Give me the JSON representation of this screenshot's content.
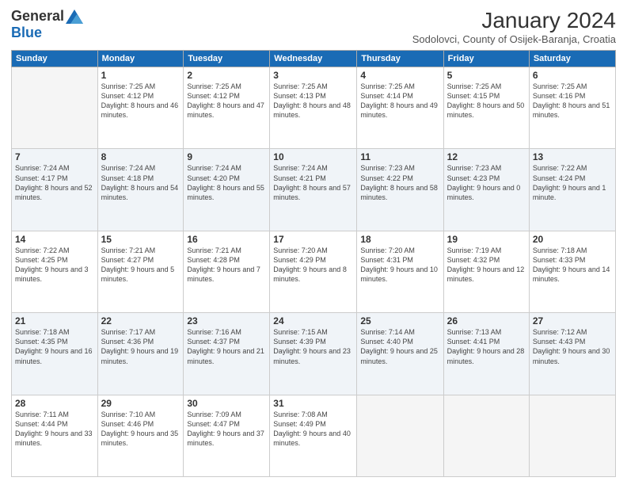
{
  "header": {
    "logo_general": "General",
    "logo_blue": "Blue",
    "month_title": "January 2024",
    "subtitle": "Sodolovci, County of Osijek-Baranja, Croatia"
  },
  "days_of_week": [
    "Sunday",
    "Monday",
    "Tuesday",
    "Wednesday",
    "Thursday",
    "Friday",
    "Saturday"
  ],
  "weeks": [
    [
      {
        "day": "",
        "empty": true
      },
      {
        "day": "1",
        "sunrise": "Sunrise: 7:25 AM",
        "sunset": "Sunset: 4:12 PM",
        "daylight": "Daylight: 8 hours and 46 minutes."
      },
      {
        "day": "2",
        "sunrise": "Sunrise: 7:25 AM",
        "sunset": "Sunset: 4:12 PM",
        "daylight": "Daylight: 8 hours and 47 minutes."
      },
      {
        "day": "3",
        "sunrise": "Sunrise: 7:25 AM",
        "sunset": "Sunset: 4:13 PM",
        "daylight": "Daylight: 8 hours and 48 minutes."
      },
      {
        "day": "4",
        "sunrise": "Sunrise: 7:25 AM",
        "sunset": "Sunset: 4:14 PM",
        "daylight": "Daylight: 8 hours and 49 minutes."
      },
      {
        "day": "5",
        "sunrise": "Sunrise: 7:25 AM",
        "sunset": "Sunset: 4:15 PM",
        "daylight": "Daylight: 8 hours and 50 minutes."
      },
      {
        "day": "6",
        "sunrise": "Sunrise: 7:25 AM",
        "sunset": "Sunset: 4:16 PM",
        "daylight": "Daylight: 8 hours and 51 minutes."
      }
    ],
    [
      {
        "day": "7",
        "sunrise": "Sunrise: 7:24 AM",
        "sunset": "Sunset: 4:17 PM",
        "daylight": "Daylight: 8 hours and 52 minutes."
      },
      {
        "day": "8",
        "sunrise": "Sunrise: 7:24 AM",
        "sunset": "Sunset: 4:18 PM",
        "daylight": "Daylight: 8 hours and 54 minutes."
      },
      {
        "day": "9",
        "sunrise": "Sunrise: 7:24 AM",
        "sunset": "Sunset: 4:20 PM",
        "daylight": "Daylight: 8 hours and 55 minutes."
      },
      {
        "day": "10",
        "sunrise": "Sunrise: 7:24 AM",
        "sunset": "Sunset: 4:21 PM",
        "daylight": "Daylight: 8 hours and 57 minutes."
      },
      {
        "day": "11",
        "sunrise": "Sunrise: 7:23 AM",
        "sunset": "Sunset: 4:22 PM",
        "daylight": "Daylight: 8 hours and 58 minutes."
      },
      {
        "day": "12",
        "sunrise": "Sunrise: 7:23 AM",
        "sunset": "Sunset: 4:23 PM",
        "daylight": "Daylight: 9 hours and 0 minutes."
      },
      {
        "day": "13",
        "sunrise": "Sunrise: 7:22 AM",
        "sunset": "Sunset: 4:24 PM",
        "daylight": "Daylight: 9 hours and 1 minute."
      }
    ],
    [
      {
        "day": "14",
        "sunrise": "Sunrise: 7:22 AM",
        "sunset": "Sunset: 4:25 PM",
        "daylight": "Daylight: 9 hours and 3 minutes."
      },
      {
        "day": "15",
        "sunrise": "Sunrise: 7:21 AM",
        "sunset": "Sunset: 4:27 PM",
        "daylight": "Daylight: 9 hours and 5 minutes."
      },
      {
        "day": "16",
        "sunrise": "Sunrise: 7:21 AM",
        "sunset": "Sunset: 4:28 PM",
        "daylight": "Daylight: 9 hours and 7 minutes."
      },
      {
        "day": "17",
        "sunrise": "Sunrise: 7:20 AM",
        "sunset": "Sunset: 4:29 PM",
        "daylight": "Daylight: 9 hours and 8 minutes."
      },
      {
        "day": "18",
        "sunrise": "Sunrise: 7:20 AM",
        "sunset": "Sunset: 4:31 PM",
        "daylight": "Daylight: 9 hours and 10 minutes."
      },
      {
        "day": "19",
        "sunrise": "Sunrise: 7:19 AM",
        "sunset": "Sunset: 4:32 PM",
        "daylight": "Daylight: 9 hours and 12 minutes."
      },
      {
        "day": "20",
        "sunrise": "Sunrise: 7:18 AM",
        "sunset": "Sunset: 4:33 PM",
        "daylight": "Daylight: 9 hours and 14 minutes."
      }
    ],
    [
      {
        "day": "21",
        "sunrise": "Sunrise: 7:18 AM",
        "sunset": "Sunset: 4:35 PM",
        "daylight": "Daylight: 9 hours and 16 minutes."
      },
      {
        "day": "22",
        "sunrise": "Sunrise: 7:17 AM",
        "sunset": "Sunset: 4:36 PM",
        "daylight": "Daylight: 9 hours and 19 minutes."
      },
      {
        "day": "23",
        "sunrise": "Sunrise: 7:16 AM",
        "sunset": "Sunset: 4:37 PM",
        "daylight": "Daylight: 9 hours and 21 minutes."
      },
      {
        "day": "24",
        "sunrise": "Sunrise: 7:15 AM",
        "sunset": "Sunset: 4:39 PM",
        "daylight": "Daylight: 9 hours and 23 minutes."
      },
      {
        "day": "25",
        "sunrise": "Sunrise: 7:14 AM",
        "sunset": "Sunset: 4:40 PM",
        "daylight": "Daylight: 9 hours and 25 minutes."
      },
      {
        "day": "26",
        "sunrise": "Sunrise: 7:13 AM",
        "sunset": "Sunset: 4:41 PM",
        "daylight": "Daylight: 9 hours and 28 minutes."
      },
      {
        "day": "27",
        "sunrise": "Sunrise: 7:12 AM",
        "sunset": "Sunset: 4:43 PM",
        "daylight": "Daylight: 9 hours and 30 minutes."
      }
    ],
    [
      {
        "day": "28",
        "sunrise": "Sunrise: 7:11 AM",
        "sunset": "Sunset: 4:44 PM",
        "daylight": "Daylight: 9 hours and 33 minutes."
      },
      {
        "day": "29",
        "sunrise": "Sunrise: 7:10 AM",
        "sunset": "Sunset: 4:46 PM",
        "daylight": "Daylight: 9 hours and 35 minutes."
      },
      {
        "day": "30",
        "sunrise": "Sunrise: 7:09 AM",
        "sunset": "Sunset: 4:47 PM",
        "daylight": "Daylight: 9 hours and 37 minutes."
      },
      {
        "day": "31",
        "sunrise": "Sunrise: 7:08 AM",
        "sunset": "Sunset: 4:49 PM",
        "daylight": "Daylight: 9 hours and 40 minutes."
      },
      {
        "day": "",
        "empty": true
      },
      {
        "day": "",
        "empty": true
      },
      {
        "day": "",
        "empty": true
      }
    ]
  ]
}
